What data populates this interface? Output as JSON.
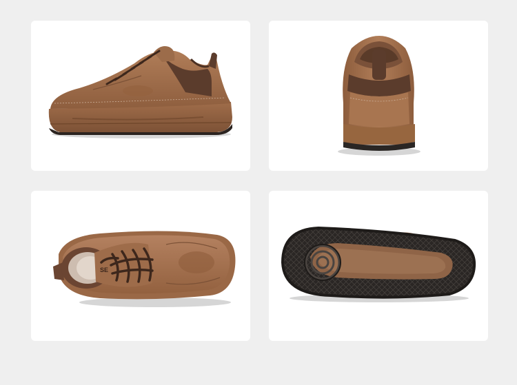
{
  "views": [
    {
      "id": "side-view",
      "label": ""
    },
    {
      "id": "back-view",
      "label": ""
    },
    {
      "id": "top-view",
      "label": ""
    },
    {
      "id": "sole-view",
      "label": ""
    }
  ],
  "colors": {
    "page_background": "#efefef",
    "card_background": "#ffffff",
    "upper_tan": "#a5734f",
    "upper_dark": "#5b3c2c",
    "sole_black": "#2a2624",
    "laces": "#3d271c"
  },
  "logo_text": "SE"
}
